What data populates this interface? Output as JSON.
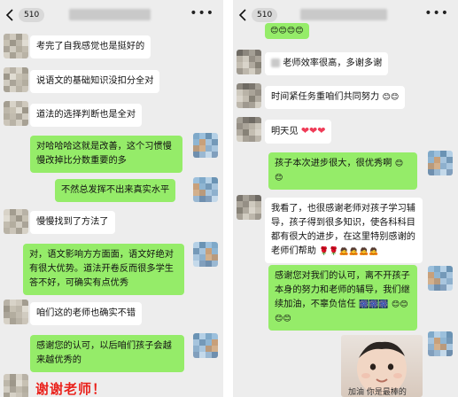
{
  "left": {
    "header": {
      "count": "510"
    },
    "messages": [
      {
        "side": "in",
        "text": "考完了自我感觉也是挺好的"
      },
      {
        "side": "in",
        "text": "说语文的基础知识没扣分全对"
      },
      {
        "side": "in",
        "text": "道法的选择判断也是全对"
      },
      {
        "side": "out",
        "text": "对哈哈哈这就是改善，这个习惯慢慢改掉比分数重要的多"
      },
      {
        "side": "out",
        "text": "不然总发挥不出来真实水平"
      },
      {
        "side": "in",
        "text": "慢慢找到了方法了"
      },
      {
        "side": "out",
        "text": "对，语文影响方方面面，语文好绝对有很大优势。道法开卷反而很多学生答不好，可确实有点优秀"
      },
      {
        "side": "in",
        "text": "咱们这的老师也确实不错"
      },
      {
        "side": "out",
        "text": "感谢您的认可，以后咱们孩子会越来越优秀的"
      }
    ],
    "sticker_text": "谢谢老师！"
  },
  "right": {
    "header": {
      "count": "510"
    },
    "messages": [
      {
        "side": "in",
        "text": "老师效率很高，多谢多谢"
      },
      {
        "side": "in",
        "text": "时间紧任务重咱们共同努力"
      },
      {
        "side": "in",
        "text": "明天见"
      },
      {
        "side": "out",
        "text": "孩子本次进步很大，很优秀啊"
      },
      {
        "side": "in",
        "text": "我看了，也很感谢老师对孩子学习辅导，孩子得到很多知识，使各科科目都有很大的进步，在这里特别感谢的老师们帮助"
      },
      {
        "side": "out",
        "text": "感谢您对我们的认可，离不开孩子本身的努力和老师的辅导，我们继续加油，不辜负信任"
      }
    ],
    "sticker_caption": "加油 你是最棒的"
  },
  "icons": {
    "back": "chevron-left-icon",
    "more": "more-dots-icon",
    "emoji_smile": "smile-emoji-icon",
    "emoji_heart": "heart-emoji-icon",
    "emoji_rose": "rose-emoji-icon",
    "emoji_bow": "bow-emoji-icon",
    "emoji_firework": "firework-emoji-icon"
  },
  "colors": {
    "chat_bg": "#ededed",
    "bubble_in": "#ffffff",
    "bubble_out": "#95ec69",
    "sticker_red": "#e8211b"
  }
}
